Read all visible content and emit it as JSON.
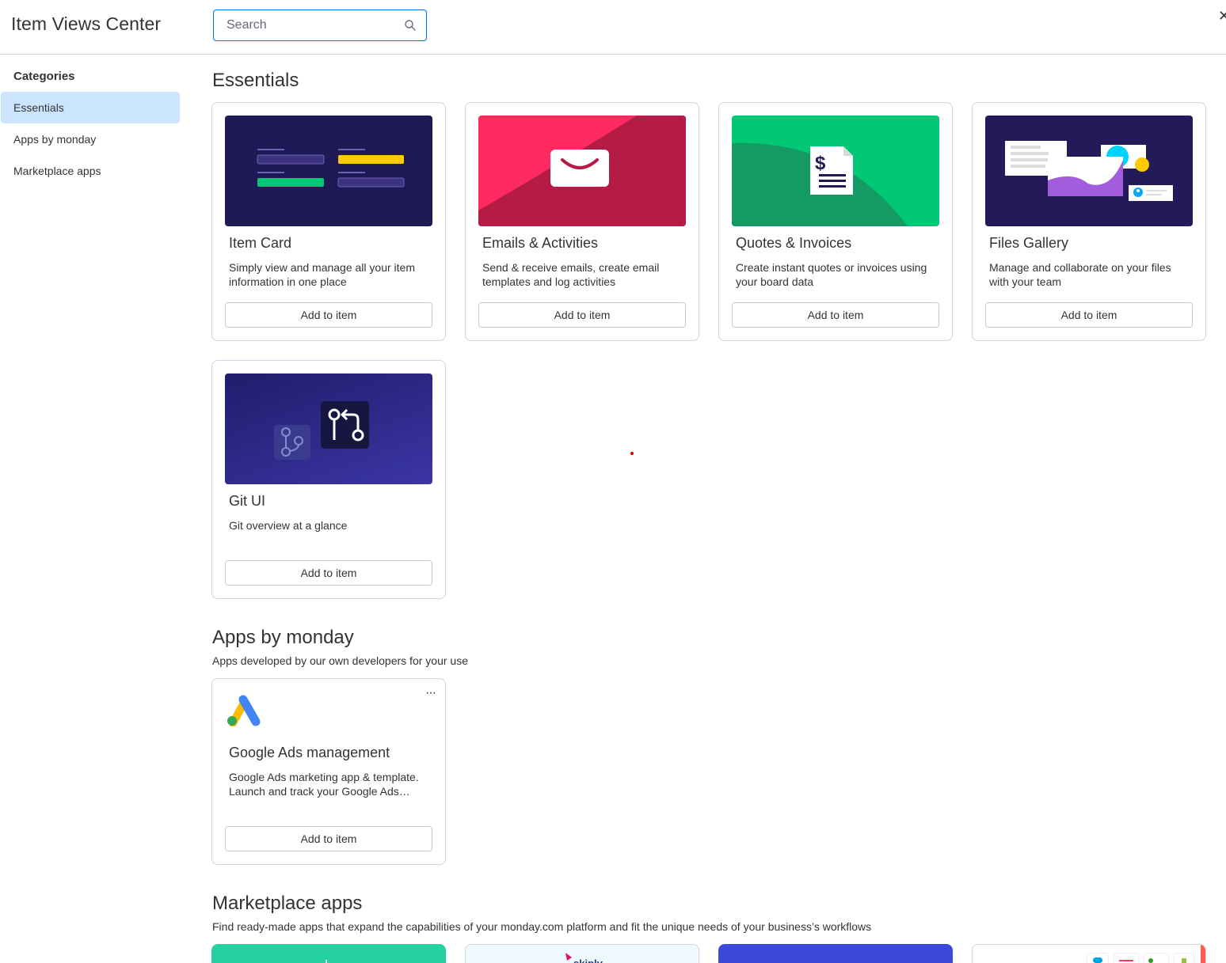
{
  "header": {
    "title": "Item Views Center",
    "search_placeholder": "Search"
  },
  "sidebar": {
    "heading": "Categories",
    "items": [
      {
        "label": "Essentials",
        "active": true
      },
      {
        "label": "Apps by monday",
        "active": false
      },
      {
        "label": "Marketplace apps",
        "active": false
      }
    ]
  },
  "sections": {
    "essentials": {
      "title": "Essentials",
      "cards": [
        {
          "title": "Item Card",
          "description": "Simply view and manage all your item information in one place",
          "button": "Add to item",
          "image": "item-card-illustration"
        },
        {
          "title": "Emails & Activities",
          "description": "Send & receive emails, create email templates and log activities",
          "button": "Add to item",
          "image": "envelope-illustration"
        },
        {
          "title": "Quotes & Invoices",
          "description": "Create instant quotes or invoices using your board data",
          "button": "Add to item",
          "image": "invoice-illustration"
        },
        {
          "title": "Files Gallery",
          "description": "Manage and collaborate on your files with your team",
          "button": "Add to item",
          "image": "files-illustration"
        },
        {
          "title": "Git UI",
          "description": "Git overview at a glance",
          "button": "Add to item",
          "image": "git-illustration"
        }
      ]
    },
    "apps_by_monday": {
      "title": "Apps by monday",
      "description": "Apps developed by our own developers for your use",
      "cards": [
        {
          "title": "Google Ads management",
          "description": "Google Ads marketing app & template. Launch and track your Google Ads…",
          "button": "Add to item",
          "icon": "google-ads-logo"
        }
      ]
    },
    "marketplace": {
      "title": "Marketplace apps",
      "description": "Find ready-made apps that expand the capabilities of your monday.com platform and fit the unique needs of your business’s workflows",
      "cards": [
        {
          "brand": ""
        },
        {
          "brand": "skiply"
        },
        {
          "brand": ""
        },
        {
          "brand": ""
        }
      ]
    }
  },
  "colors": {
    "accent": "#0073ea",
    "active_bg": "#cce5ff",
    "text": "#323338",
    "border": "#d0d4e4",
    "item_card_bg": "#1f1a55",
    "emails_bg": "#ff2a5f",
    "quotes_bg": "#00c875",
    "files_bg": "#231a5a",
    "git_bg": "#3b36a5"
  }
}
